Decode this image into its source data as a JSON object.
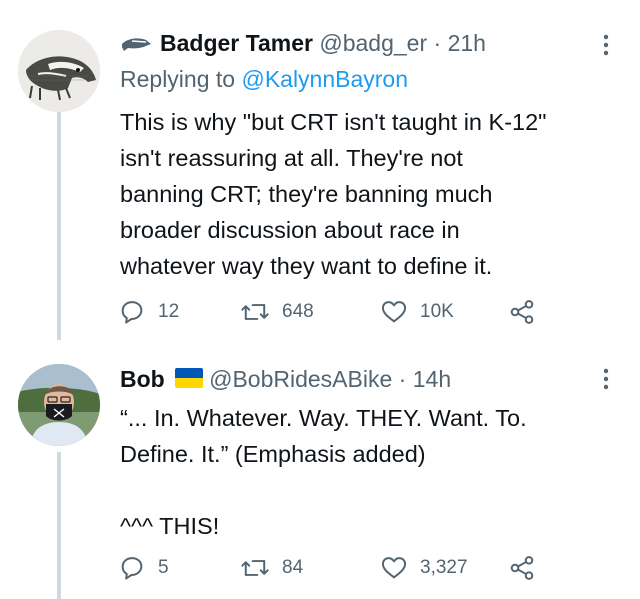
{
  "tweets": [
    {
      "display_name": "Badger Tamer",
      "handle": "@badg_er",
      "separator": "·",
      "time": "21h",
      "replying_prefix": "Replying to",
      "replying_to": "@KalynnBayron",
      "lines": [
        "This is why \"but CRT isn't taught in K-12\"",
        "isn't reassuring at all. They're not",
        "banning CRT; they're banning much",
        "broader discussion about race in",
        "whatever way they want to define it."
      ],
      "badge_icon": "badger-icon",
      "avatar_icon": "badger-drawing-avatar",
      "actions": {
        "replies": "12",
        "retweets": "648",
        "likes": "10K"
      }
    },
    {
      "display_name": "Bob",
      "handle": "@BobRidesABike",
      "separator": "·",
      "time": "14h",
      "lines": [
        "“... In. Whatever. Way. THEY. Want. To.",
        "Define. It.” (Emphasis added)",
        "",
        "^^^ THIS!"
      ],
      "badge_icon": "ukraine-flag-icon",
      "avatar_icon": "man-with-mask-avatar",
      "actions": {
        "replies": "5",
        "retweets": "84",
        "likes": "3,327"
      }
    }
  ],
  "colors": {
    "text": "#0f1419",
    "secondary": "#536471",
    "link": "#1d9bf0",
    "thread_line": "#cfd9de",
    "flag_blue": "#0057b7",
    "flag_yellow": "#ffd700"
  }
}
